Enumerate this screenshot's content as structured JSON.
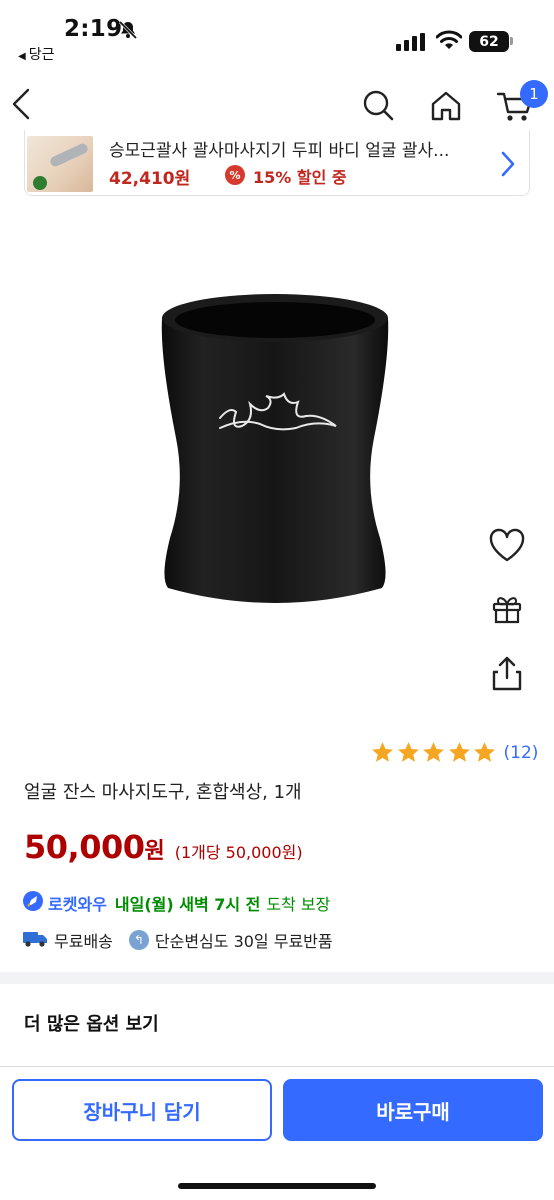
{
  "status_bar": {
    "time": "2:19",
    "back_app": "당근",
    "battery": "62"
  },
  "nav": {
    "cart_count": "1"
  },
  "ad": {
    "title": "승모근괄사 괄사마사지기 두피 바디 얼굴 괄사...",
    "price": "42,410원",
    "discount_icon": "%",
    "discount": "15% 할인 중"
  },
  "product": {
    "title": "얼굴 잔스 마사지도구, 혼합색상, 1개",
    "rating": 5,
    "review_count": "(12)",
    "price": "50,000",
    "price_currency": "원",
    "unit_price": "(1개당 50,000원)"
  },
  "delivery": {
    "rocket_name": "로켓와우",
    "arrival": "내일(월) 새벽 7시 전",
    "arrival_note": "도착 보장",
    "free_shipping": "무료배송",
    "return_policy": "단순변심도 30일 무료반품"
  },
  "more_options": "더 많은 옵션 보기",
  "bottom": {
    "cart_button": "장바구니 담기",
    "buy_button": "바로구매"
  },
  "icons": {
    "nav": [
      "back-icon",
      "search-icon",
      "home-icon",
      "cart-icon"
    ],
    "side": [
      "heart-icon",
      "gift-icon",
      "share-icon"
    ]
  },
  "colors": {
    "accent": "#346aff",
    "price": "#ae0000",
    "delivery": "#008c00",
    "star": "#f5a623"
  }
}
